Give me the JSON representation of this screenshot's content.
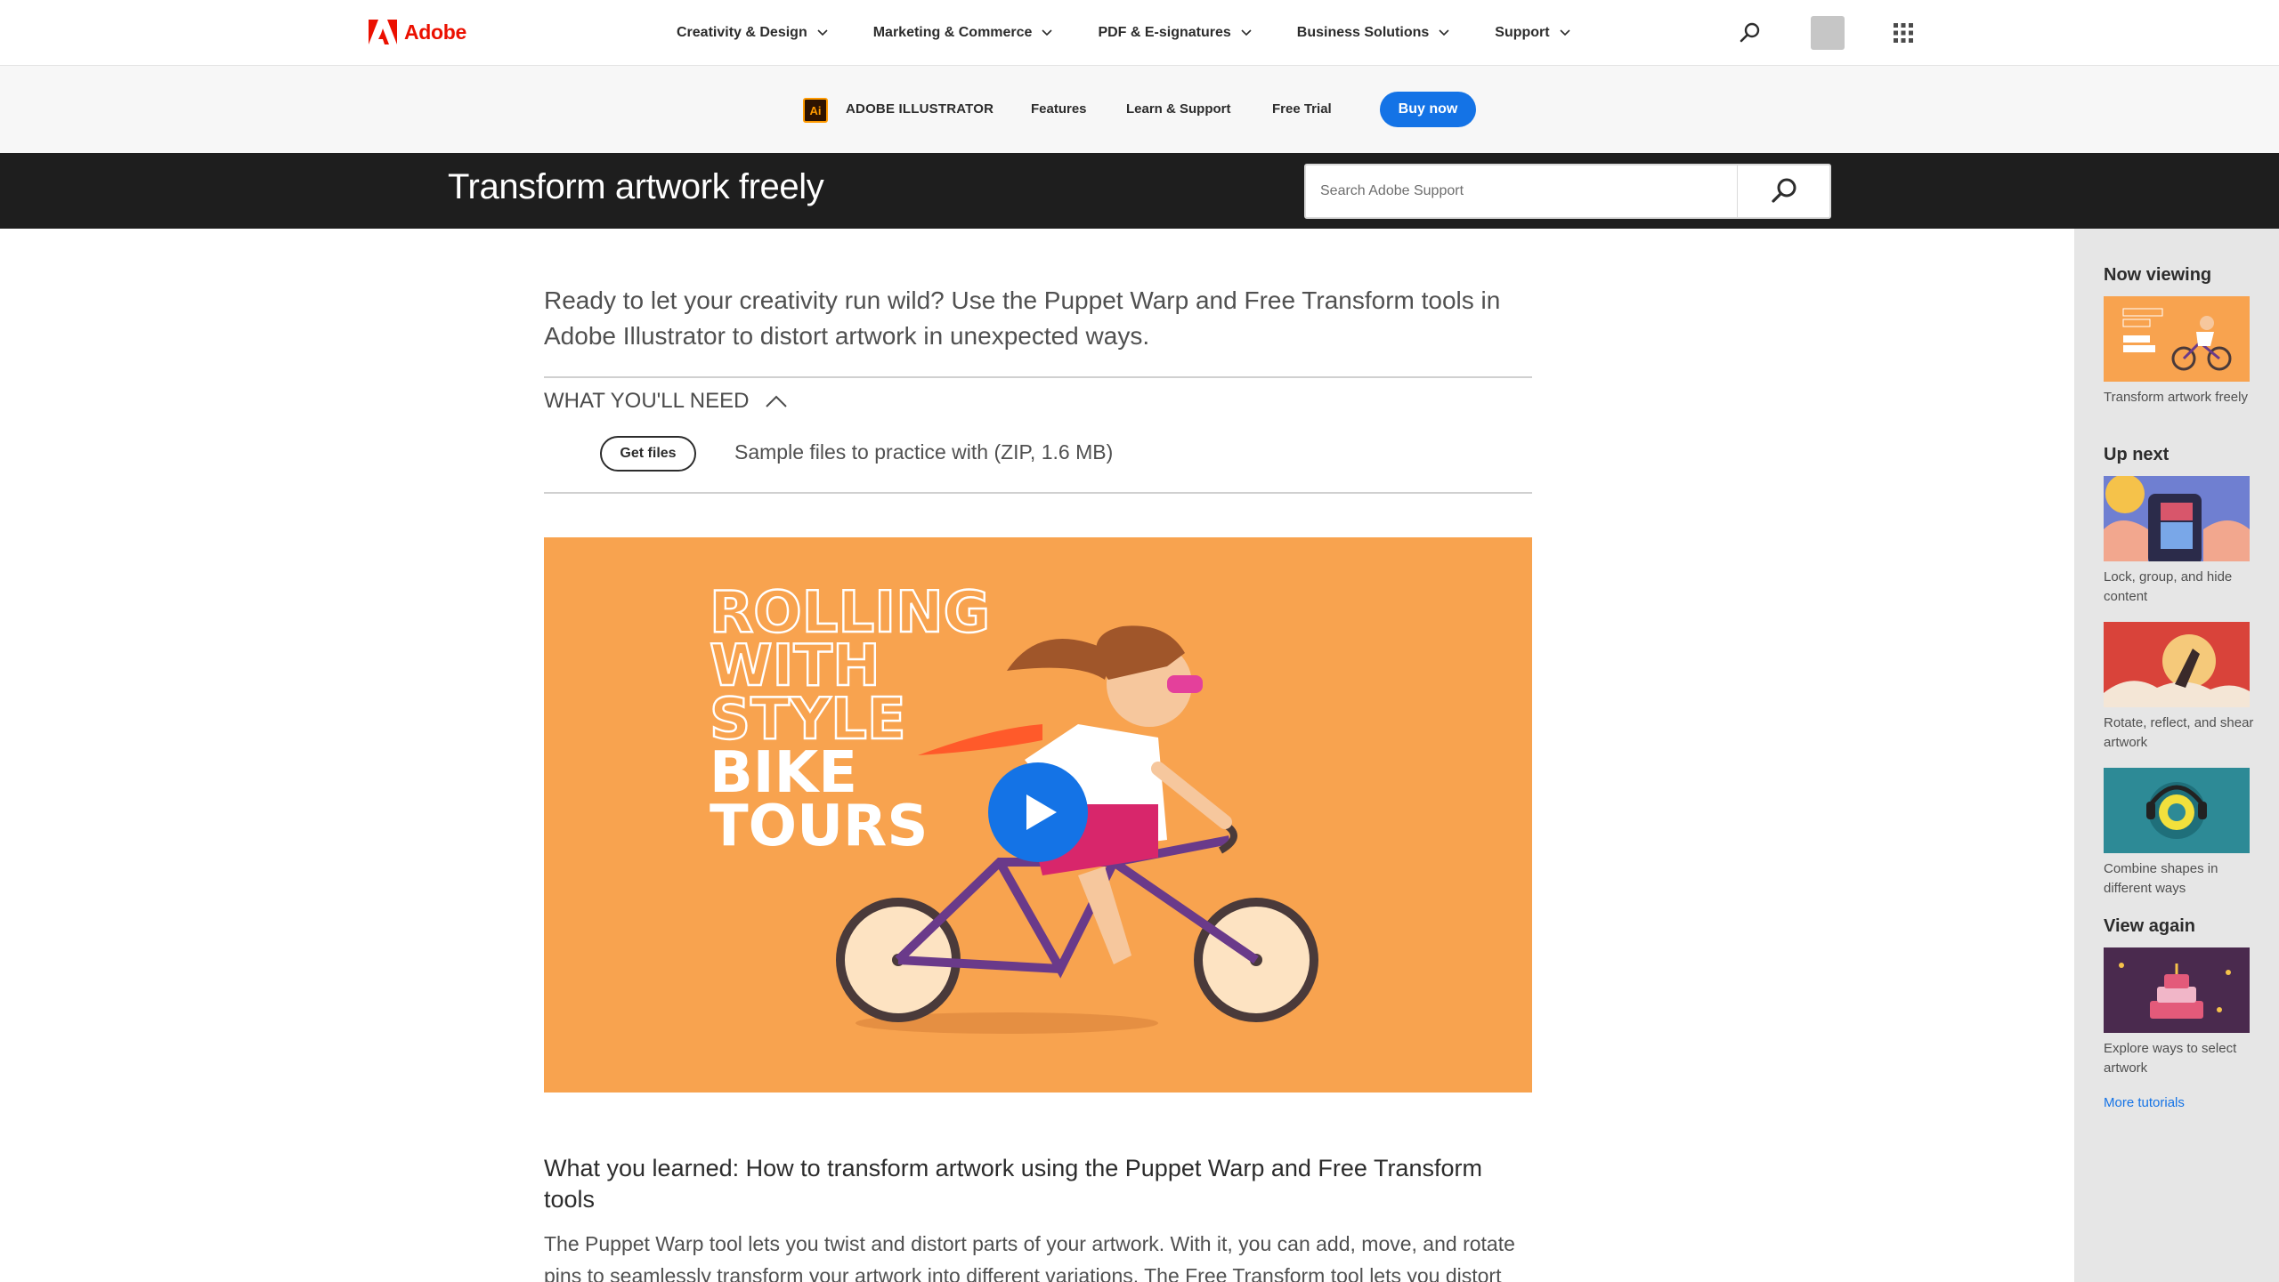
{
  "gnav": {
    "brand": "Adobe",
    "items": [
      "Creativity & Design",
      "Marketing & Commerce",
      "PDF & E-signatures",
      "Business Solutions",
      "Support"
    ]
  },
  "subnav": {
    "product_icon": "Ai",
    "product": "ADOBE ILLUSTRATOR",
    "links": [
      "Features",
      "Learn & Support",
      "Free Trial"
    ],
    "buy": "Buy now"
  },
  "header": {
    "title": "Transform artwork freely",
    "search_placeholder": "Search Adobe Support"
  },
  "main": {
    "intro": "Ready to let your creativity run wild? Use the Puppet Warp and Free Transform tools in Adobe Illustrator to distort artwork in unexpected ways.",
    "need_heading": "WHAT YOU'LL NEED",
    "get_files": "Get files",
    "files_desc": "Sample files to practice with (ZIP, 1.6 MB)",
    "video_text": [
      "ROLLING",
      "WITH",
      "STYLE",
      "BIKE",
      "TOURS"
    ],
    "learned_heading": "What you learned: How to transform artwork using the Puppet Warp and Free Transform tools",
    "learned_body": "The Puppet Warp tool lets you twist and distort parts of your artwork. With it, you can add, move, and rotate pins to seamlessly transform your artwork into different variations. The Free Transform tool lets you distort"
  },
  "rail": {
    "now_viewing": "Now viewing",
    "now_item": "Transform artwork freely",
    "up_next": "Up next",
    "next_items": [
      "Lock, group, and hide content",
      "Rotate, reflect, and shear artwork",
      "Combine shapes in different ways"
    ],
    "view_again": "View again",
    "again_item": "Explore ways to select artwork",
    "more": "More tutorials"
  },
  "colors": {
    "adobe_red": "#eb1000",
    "accent_blue": "#1473e6",
    "title_band": "#1e1e1e",
    "video_bg": "#f8a34f"
  }
}
